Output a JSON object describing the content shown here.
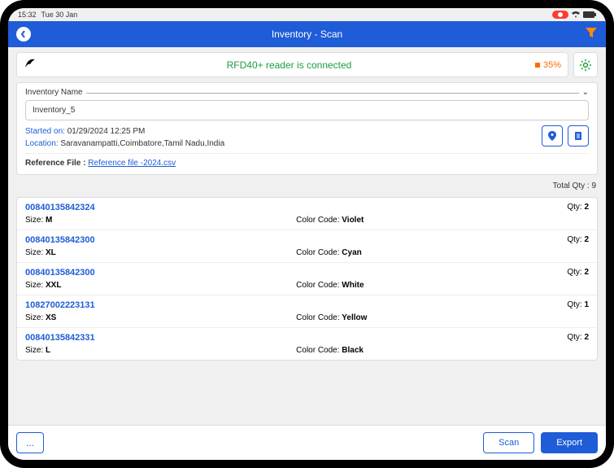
{
  "statusbar": {
    "time": "15:32",
    "date": "Tue 30 Jan"
  },
  "appbar": {
    "title": "Inventory - Scan"
  },
  "reader": {
    "status_text": "RFD40+ reader is connected",
    "battery_pct": "35%"
  },
  "inventory": {
    "fieldset_label": "Inventory Name",
    "name": "Inventory_5",
    "started_label": "Started on:",
    "started_value": "01/29/2024 12:25 PM",
    "location_label": "Location:",
    "location_value": "Saravanampatti,Coimbatore,Tamil Nadu,India",
    "ref_label": "Reference File :",
    "ref_link": "Reference file -2024.csv"
  },
  "totals": {
    "label": "Total Qty :",
    "value": "9"
  },
  "labels": {
    "qty": "Qty:",
    "size": "Size:",
    "color": "Color Code:"
  },
  "items": [
    {
      "sku": "00840135842324",
      "size": "M",
      "color": "Violet",
      "qty": "2"
    },
    {
      "sku": "00840135842300",
      "size": "XL",
      "color": "Cyan",
      "qty": "2"
    },
    {
      "sku": "00840135842300",
      "size": "XXL",
      "color": "White",
      "qty": "2"
    },
    {
      "sku": "10827002223131",
      "size": "XS",
      "color": "Yellow",
      "qty": "1"
    },
    {
      "sku": "00840135842331",
      "size": "L",
      "color": "Black",
      "qty": "2"
    }
  ],
  "footer": {
    "more": "...",
    "scan": "Scan",
    "export": "Export"
  }
}
